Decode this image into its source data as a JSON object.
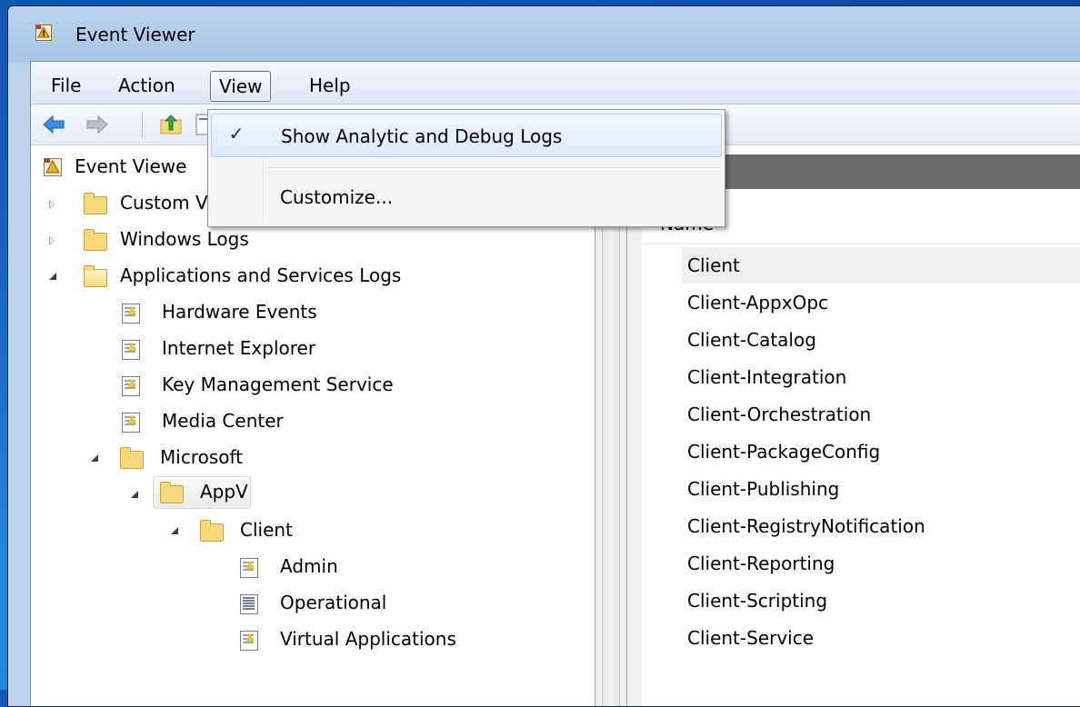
{
  "window": {
    "title": "Event Viewer"
  },
  "menubar": {
    "items": [
      "File",
      "Action",
      "View",
      "Help"
    ]
  },
  "view_menu": {
    "items": [
      {
        "label": "Show Analytic and Debug Logs",
        "checked": true
      },
      {
        "label": "Customize...",
        "checked": false
      }
    ]
  },
  "tree": {
    "root_label": "Event Viewe",
    "items": [
      {
        "label": "Custom Views",
        "icon": "filter-folder-icon"
      },
      {
        "label": "Windows Logs",
        "icon": "windows-folder-icon"
      },
      {
        "label": "Applications and Services Logs",
        "icon": "open-folder-icon"
      },
      {
        "label": "Hardware Events",
        "icon": "event-log-icon"
      },
      {
        "label": "Internet Explorer",
        "icon": "event-log-icon"
      },
      {
        "label": "Key Management Service",
        "icon": "event-log-icon"
      },
      {
        "label": "Media Center",
        "icon": "event-log-icon"
      },
      {
        "label": "Microsoft",
        "icon": "folder-icon"
      },
      {
        "label": "AppV",
        "icon": "folder-icon"
      },
      {
        "label": "Client",
        "icon": "folder-icon"
      },
      {
        "label": "Admin",
        "icon": "event-log-icon"
      },
      {
        "label": "Operational",
        "icon": "log-file-icon"
      },
      {
        "label": "Virtual Applications",
        "icon": "event-log-icon"
      }
    ]
  },
  "list": {
    "column_header": "Name",
    "rows": [
      "Client",
      "Client-AppxOpc",
      "Client-Catalog",
      "Client-Integration",
      "Client-Orchestration",
      "Client-PackageConfig",
      "Client-Publishing",
      "Client-RegistryNotification",
      "Client-Reporting",
      "Client-Scripting",
      "Client-Service"
    ]
  },
  "colors": {
    "desktop": "#1565c0",
    "menu_highlight": "#dcebfc",
    "pane_header": "#6b6b6b"
  }
}
